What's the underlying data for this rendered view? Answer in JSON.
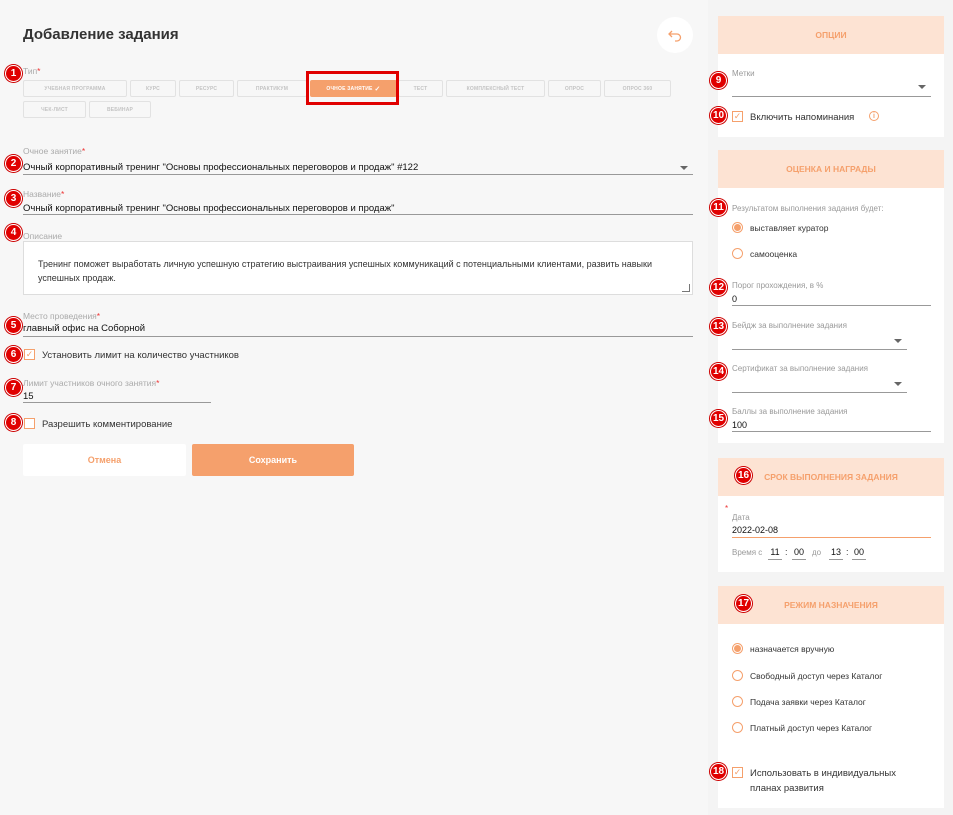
{
  "page": {
    "title": "Добавление задания"
  },
  "type": {
    "label": "Тип",
    "tabs": [
      "Учебная программа",
      "Курс",
      "Ресурс",
      "Практикум",
      "Очное занятие",
      "Тест",
      "Комплексный тест",
      "Опрос",
      "Опрос 360",
      "Чек-лист",
      "Вебинар"
    ],
    "active": "Очное занятие"
  },
  "session": {
    "label": "Очное занятие",
    "value": "Очный корпоративный тренинг \"Основы профессиональных переговоров и продаж\" #122"
  },
  "name": {
    "label": "Название",
    "value": "Очный корпоративный тренинг \"Основы профессиональных переговоров и продаж\""
  },
  "description": {
    "label": "Описание",
    "line1": "Тренинг поможет выработать личную успешную стратегию выстраивания успешных коммуникаций с потенциальными клиентами, развить навыки",
    "line2": "успешных продаж."
  },
  "venue": {
    "label": "Место проведения",
    "value": "главный офис на Соборной"
  },
  "limit_toggle": {
    "label": "Установить лимит на количество участников",
    "checked": true
  },
  "limit": {
    "label": "Лимит участников очного занятия",
    "value": "15"
  },
  "comments": {
    "label": "Разрешить комментирование",
    "checked": false
  },
  "buttons": {
    "cancel": "Отмена",
    "save": "Сохранить"
  },
  "options": {
    "title": "Опции",
    "tags_label": "Метки",
    "reminders_label": "Включить напоминания",
    "reminders_checked": true
  },
  "rating": {
    "title": "Оценка и награды",
    "result_label": "Результатом выполнения задания будет:",
    "result_options": [
      "выставляет куратор",
      "самооценка"
    ],
    "result_selected": 0,
    "threshold_label": "Порог прохождения, в %",
    "threshold_value": "0",
    "badge_label": "Бейдж за выполнение задания",
    "certificate_label": "Сертификат за выполнение задания",
    "points_label": "Баллы за выполнение задания",
    "points_value": "100"
  },
  "deadline": {
    "title": "Срок выполнения задания",
    "date_label": "Дата",
    "date_value": "2022-02-08",
    "time_from_label": "Время с",
    "time_to_label": "до",
    "from_h": "11",
    "from_m": "00",
    "to_h": "13",
    "to_m": "00"
  },
  "assignment": {
    "title": "Режим назначения",
    "options": [
      "назначается вручную",
      "Свободный доступ через Каталог",
      "Подача заявки через Каталог",
      "Платный доступ через Каталог"
    ],
    "selected": 0,
    "idp_line1": "Использовать в индивидуальных",
    "idp_line2": "планах развития",
    "idp_checked": true
  },
  "markers": [
    "1",
    "2",
    "3",
    "4",
    "5",
    "6",
    "7",
    "8",
    "9",
    "10",
    "11",
    "12",
    "13",
    "14",
    "15",
    "16",
    "17",
    "18"
  ],
  "colors": {
    "accent": "#f5a06c",
    "panel_header": "#fde3d3",
    "marker": "#e00000"
  }
}
